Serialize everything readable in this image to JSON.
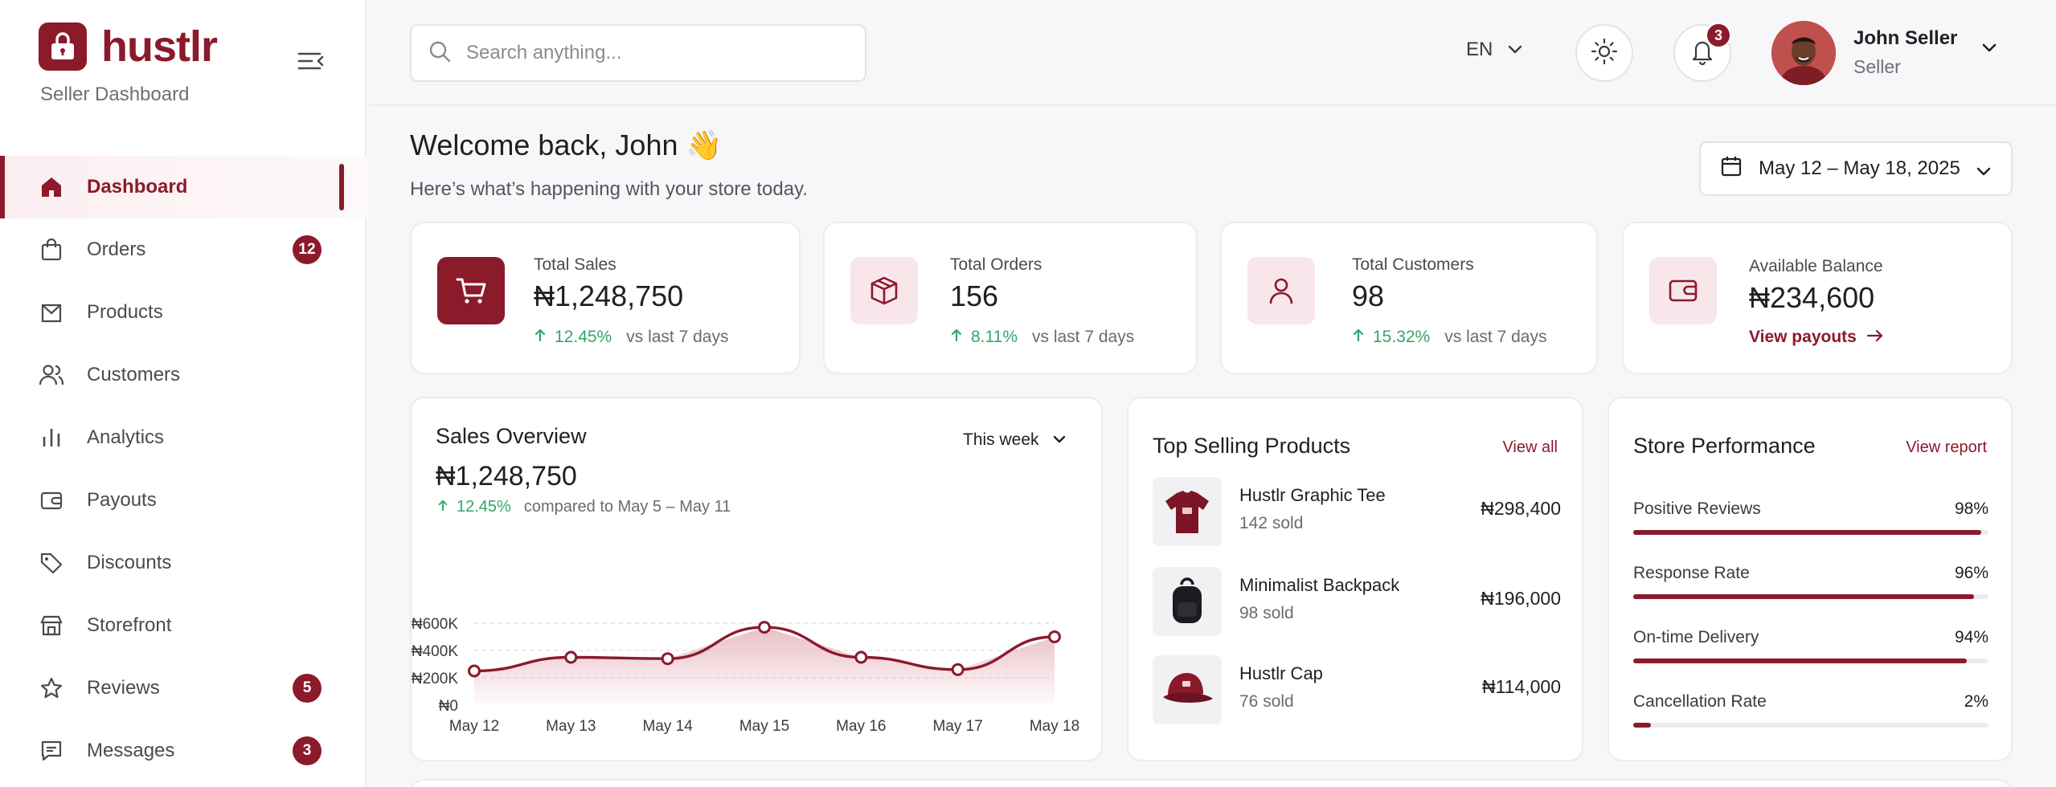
{
  "brand": {
    "name": "hustlr",
    "subtitle": "Seller Dashboard"
  },
  "sidebar": {
    "items": [
      {
        "label": "Dashboard",
        "icon": "home-icon",
        "active": true
      },
      {
        "label": "Orders",
        "icon": "bag-icon",
        "badge": "12"
      },
      {
        "label": "Products",
        "icon": "box-icon"
      },
      {
        "label": "Customers",
        "icon": "users-icon"
      },
      {
        "label": "Analytics",
        "icon": "bar-chart-icon"
      },
      {
        "label": "Payouts",
        "icon": "wallet-icon"
      },
      {
        "label": "Discounts",
        "icon": "tag-icon"
      },
      {
        "label": "Storefront",
        "icon": "store-icon"
      },
      {
        "label": "Reviews",
        "icon": "star-icon",
        "badge": "5"
      },
      {
        "label": "Messages",
        "icon": "message-icon",
        "badge": "3"
      }
    ]
  },
  "topbar": {
    "search_placeholder": "Search anything...",
    "language": "EN",
    "notifications_count": "3",
    "user": {
      "name": "John Seller",
      "role": "Seller"
    }
  },
  "welcome": {
    "title": "Welcome back, John 👋",
    "subtitle": "Here’s what’s happening with your store today.",
    "date_range": "May 12 – May 18, 2025"
  },
  "stats": {
    "sales": {
      "label": "Total Sales",
      "value": "₦1,248,750",
      "change": "12.45%",
      "vs": "vs last 7 days"
    },
    "orders": {
      "label": "Total Orders",
      "value": "156",
      "change": "8.11%",
      "vs": "vs last 7 days"
    },
    "customers": {
      "label": "Total Customers",
      "value": "98",
      "change": "15.32%",
      "vs": "vs last 7 days"
    },
    "balance": {
      "label": "Available Balance",
      "value": "₦234,600",
      "link": "View payouts"
    }
  },
  "sales_overview": {
    "title": "Sales Overview",
    "range": "This week",
    "value": "₦1,248,750",
    "change": "12.45%",
    "compare": "compared to May 5 – May 11"
  },
  "chart_data": {
    "type": "area",
    "categories": [
      "May 12",
      "May 13",
      "May 14",
      "May 15",
      "May 16",
      "May 17",
      "May 18"
    ],
    "values": [
      250000,
      350000,
      340000,
      570000,
      350000,
      260000,
      500000
    ],
    "yticks": [
      "₦0",
      "₦200K",
      "₦400K",
      "₦600K"
    ],
    "ylim": [
      0,
      600000
    ],
    "grid": true,
    "colors": {
      "line": "#8b1a2b",
      "fill": "#e7b3bd"
    }
  },
  "top_selling": {
    "title": "Top Selling Products",
    "link": "View all",
    "products": [
      {
        "name": "Hustlr Graphic Tee",
        "sold": "142 sold",
        "amount": "₦298,400"
      },
      {
        "name": "Minimalist Backpack",
        "sold": "98 sold",
        "amount": "₦196,000"
      },
      {
        "name": "Hustlr Cap",
        "sold": "76 sold",
        "amount": "₦114,000"
      }
    ]
  },
  "store_performance": {
    "title": "Store Performance",
    "link": "View report",
    "metrics": [
      {
        "label": "Positive Reviews",
        "value": "98%",
        "fraction": 0.98
      },
      {
        "label": "Response Rate",
        "value": "96%",
        "fraction": 0.96
      },
      {
        "label": "On-time Delivery",
        "value": "94%",
        "fraction": 0.94
      },
      {
        "label": "Cancellation Rate",
        "value": "2%",
        "fraction": 0.05
      }
    ]
  },
  "colors": {
    "accent": "#8b1a2b",
    "accent_soft": "#f8e6ea",
    "positive": "#34a567"
  }
}
